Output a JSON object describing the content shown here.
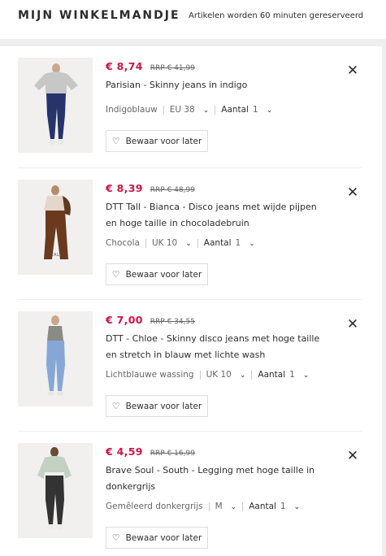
{
  "header": {
    "title": "MIJN WINKELMANDJE",
    "note": "Artikelen worden 60 minuten gereserveerd"
  },
  "items": [
    {
      "price": "€ 8,74",
      "rrp": "RRP € 41,99",
      "name": "Parisian - Skinny jeans in indigo",
      "color": "Indigoblauw",
      "size": "EU 38",
      "qty_label": "Aantal",
      "qty": "1",
      "save_label": "Bewaar voor later",
      "image_tag": ""
    },
    {
      "price": "€ 8,39",
      "rrp": "RRP € 48,99",
      "name": "DTT Tall - Bianca - Disco jeans met wijde pijpen en hoge taille in chocoladebruin",
      "color": "Chocola",
      "size": "UK 10",
      "qty_label": "Aantal",
      "qty": "1",
      "save_label": "Bewaar voor later",
      "image_tag": "TALL"
    },
    {
      "price": "€ 7,00",
      "rrp": "RRP € 34,55",
      "name": "DTT - Chloe - Skinny disco jeans met hoge taille en stretch in blauw met lichte wash",
      "color": "Lichtblauwe wassing",
      "size": "UK 10",
      "qty_label": "Aantal",
      "qty": "1",
      "save_label": "Bewaar voor later",
      "image_tag": ""
    },
    {
      "price": "€ 4,59",
      "rrp": "RRP € 16,99",
      "name": "Brave Soul - South - Legging met hoge taille in donkergrijs",
      "color": "Gemêleerd donkergrijs",
      "size": "M",
      "qty_label": "Aantal",
      "qty": "1",
      "save_label": "Bewaar voor later",
      "image_tag": ""
    }
  ],
  "icons": {
    "close": "close-icon",
    "heart": "heart-icon",
    "chevron": "chevron-down-icon"
  },
  "colors": {
    "sale_price": "#d01345",
    "text": "#2d2d2d",
    "muted": "#666666",
    "background": "#eeeeee"
  }
}
